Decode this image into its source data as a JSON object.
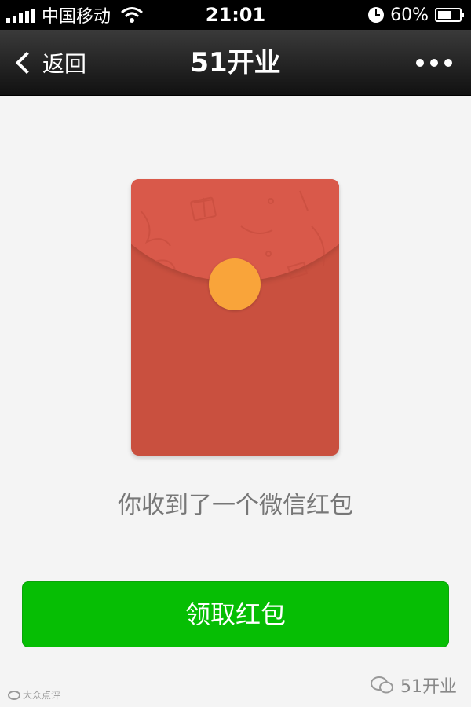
{
  "status_bar": {
    "carrier": "中国移动",
    "time": "21:01",
    "battery": "60%",
    "battery_level": 0.6,
    "icons": [
      "signal-icon",
      "wifi-icon",
      "clock-icon",
      "battery-icon"
    ]
  },
  "nav": {
    "back_label": "返回",
    "title": "51开业",
    "back_icon": "chevron-left-icon",
    "more_icon": "more-dots-icon"
  },
  "envelope": {
    "body_color": "#c9503f",
    "flap_color": "#d9594a",
    "seal_color": "#f9a43a"
  },
  "message": "你收到了一个微信红包",
  "open_button_label": "领取红包",
  "colors": {
    "accent_green": "#06be04"
  },
  "watermarks": {
    "left": "大众点评",
    "right": "51开业"
  }
}
